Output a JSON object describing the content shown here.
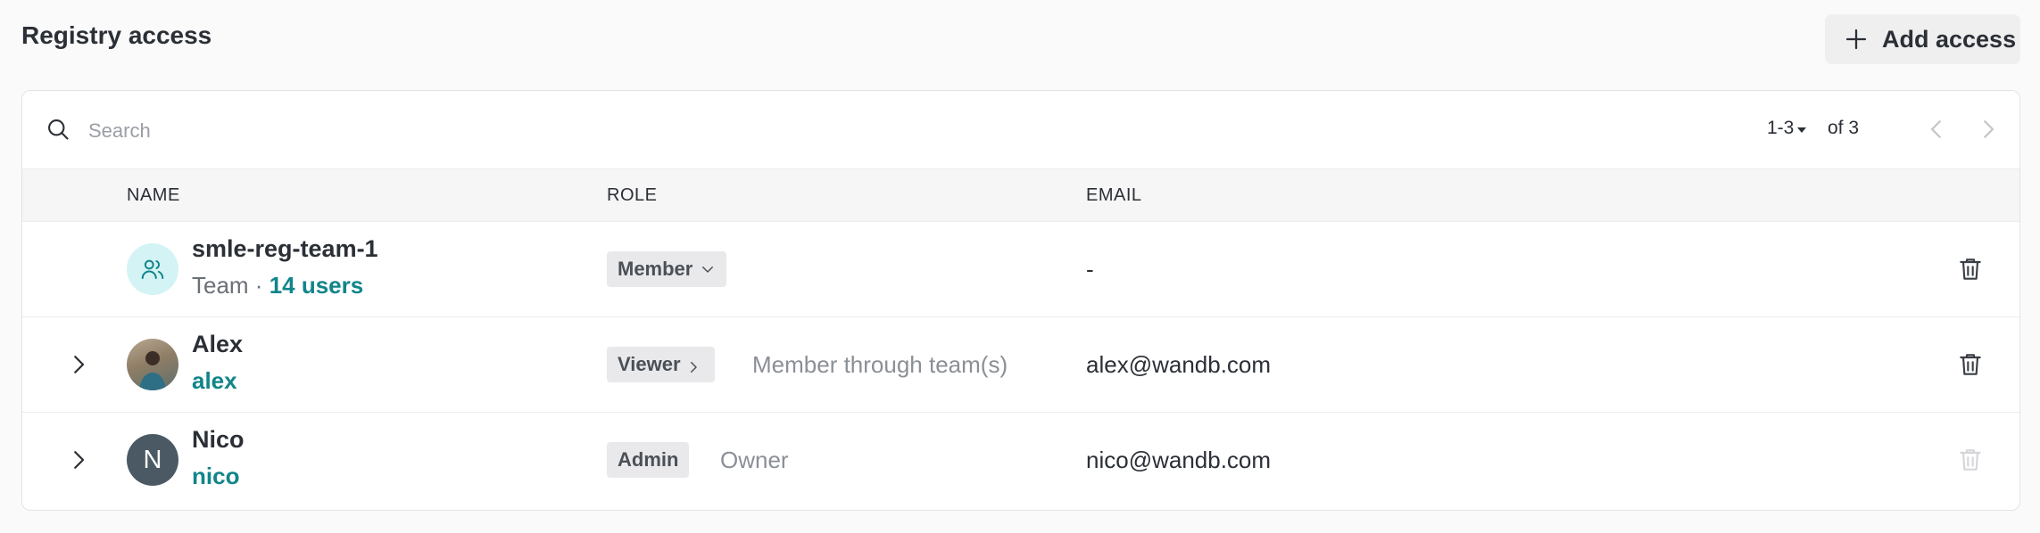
{
  "header": {
    "title": "Registry access",
    "add_button_label": "Add access"
  },
  "search": {
    "placeholder": "Search",
    "value": ""
  },
  "pagination": {
    "range": "1-3",
    "of_total": "of 3"
  },
  "columns": {
    "name": "NAME",
    "role": "ROLE",
    "email": "EMAIL"
  },
  "rows": [
    {
      "name": "smle-reg-team-1",
      "type_label": "Team",
      "separator": " · ",
      "users_link": "14 users",
      "role": "Member",
      "role_note": "",
      "email": "-"
    },
    {
      "name": "Alex",
      "username": "alex",
      "role": "Viewer",
      "role_note": "Member through team(s)",
      "email": "alex@wandb.com"
    },
    {
      "name": "Nico",
      "username": "nico",
      "avatar_letter": "N",
      "role": "Admin",
      "role_note": "Owner",
      "email": "nico@wandb.com"
    }
  ],
  "icons": {
    "add": "plus-icon",
    "search": "search-icon",
    "prev": "chevron-left-icon",
    "next": "chevron-right-icon",
    "expand": "chevron-right-icon",
    "team": "users-icon",
    "delete": "trash-icon"
  },
  "colors": {
    "accent_link": "#11858a",
    "team_avatar_bg": "#d4f3f5",
    "letter_avatar_bg": "#4a5963"
  }
}
